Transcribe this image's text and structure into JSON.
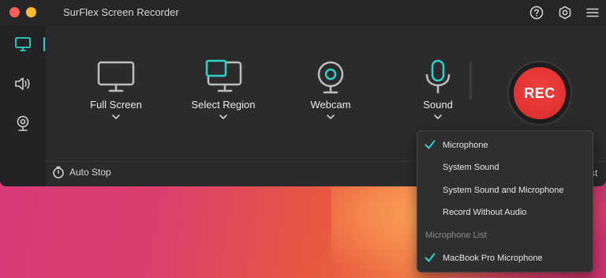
{
  "window": {
    "title": "SurFlex Screen Recorder"
  },
  "titlebar_icons": [
    "help-icon",
    "settings-icon",
    "menu-icon"
  ],
  "sidebar": {
    "items": [
      "monitor-icon",
      "speaker-icon",
      "webcam-icon"
    ],
    "active": 0
  },
  "modes": [
    {
      "label": "Full Screen",
      "icon": "monitor-icon"
    },
    {
      "label": "Select Region",
      "icon": "region-icon"
    },
    {
      "label": "Webcam",
      "icon": "webcam-icon"
    },
    {
      "label": "Sound",
      "icon": "microphone-icon"
    }
  ],
  "record_button": {
    "label": "REC",
    "color": "#e8312f"
  },
  "footer": {
    "auto_stop": "Auto Stop",
    "list_partial": "st"
  },
  "sound_menu": {
    "items": [
      {
        "label": "Microphone",
        "checked": true
      },
      {
        "label": "System Sound",
        "checked": false
      },
      {
        "label": "System Sound and Microphone",
        "checked": false
      },
      {
        "label": "Record Without Audio",
        "checked": false
      }
    ],
    "section_title": "Microphone List",
    "devices": [
      {
        "label": "MacBook Pro Microphone",
        "checked": true
      }
    ]
  },
  "colors": {
    "accent": "#2ed3c6",
    "window_bg": "#2b2b2d",
    "rec": "#e8312f"
  }
}
